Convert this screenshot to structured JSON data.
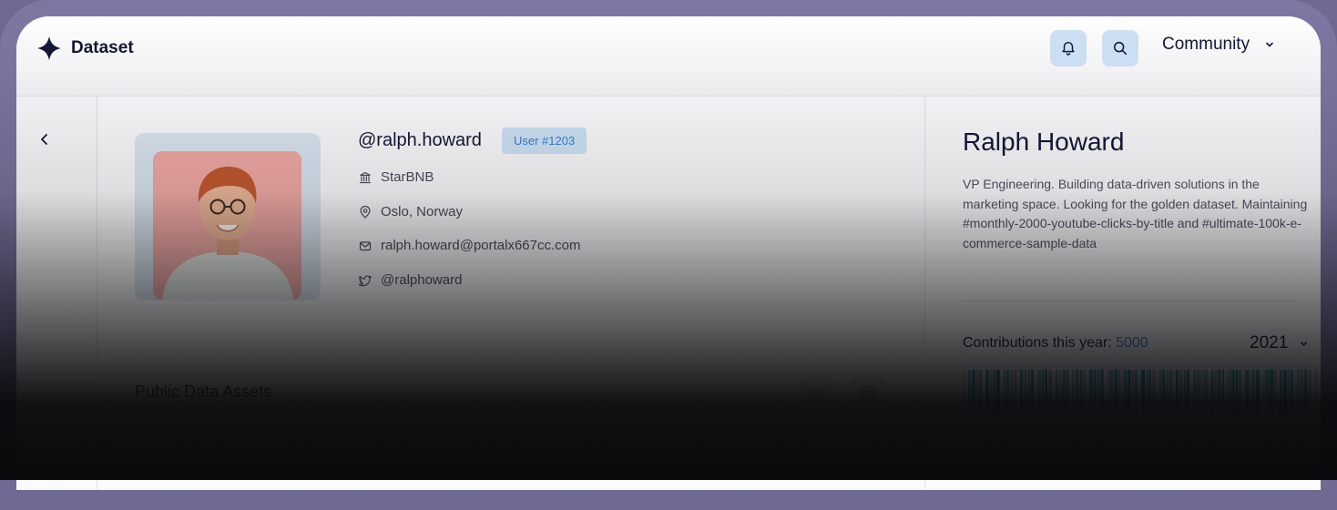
{
  "header": {
    "brand": "Dataset",
    "community_label": "Community",
    "icons": [
      "bell-icon",
      "search-icon",
      "chevron-down-icon"
    ]
  },
  "nav": {
    "back_icon": "chevron-left-icon"
  },
  "profile": {
    "username": "@ralph.howard",
    "user_badge": "User #1203",
    "company": "StarBNB",
    "location": "Oslo, Norway",
    "email": "ralph.howard@portalx667cc.com",
    "twitter": "@ralphoward"
  },
  "about": {
    "name": "Ralph Howard",
    "bio": "VP Engineering. Building data-driven solutions in the marketing space. Looking for the golden dataset. Maintaining #monthly-2000-youtube-clicks-by-title and #ultimate-100k-e-commerce-sample-data",
    "contributions_label": "Contributions this year:",
    "contributions_value": "5000",
    "year": "2021"
  },
  "assets": {
    "title": "Public Data Assets"
  },
  "colors": {
    "accent": "#3a7fd0",
    "badge_bg": "#cfe3f6",
    "frame": "#7d78a3",
    "heatmap": "#1f8fb8"
  }
}
